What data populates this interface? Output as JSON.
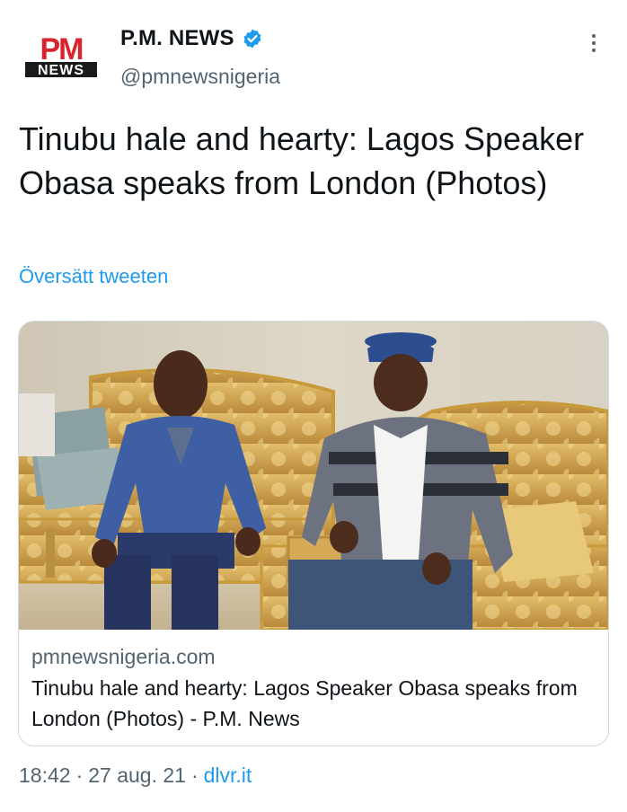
{
  "author": {
    "name": "P.M. NEWS",
    "handle": "@pmnewsnigeria",
    "logo_top": "PM",
    "logo_bottom": "NEWS"
  },
  "tweet": {
    "text": "Tinubu hale and hearty: Lagos Speaker Obasa speaks from London (Photos)",
    "translate_label": "Översätt tweeten"
  },
  "card": {
    "domain": "pmnewsnigeria.com",
    "title": "Tinubu hale and hearty: Lagos Speaker Obasa speaks from London (Photos) - P.M. News"
  },
  "meta": {
    "time": "18:42",
    "separator": "·",
    "date": "27 aug. 21",
    "source": "dlvr.it"
  },
  "colors": {
    "accent": "#1d9bf0",
    "text": "#0f1419",
    "secondary": "#536471",
    "brand_red": "#d9232d",
    "border": "#cfd9de"
  },
  "icons": {
    "verified": "verified-badge-icon",
    "more": "more-options-icon"
  }
}
